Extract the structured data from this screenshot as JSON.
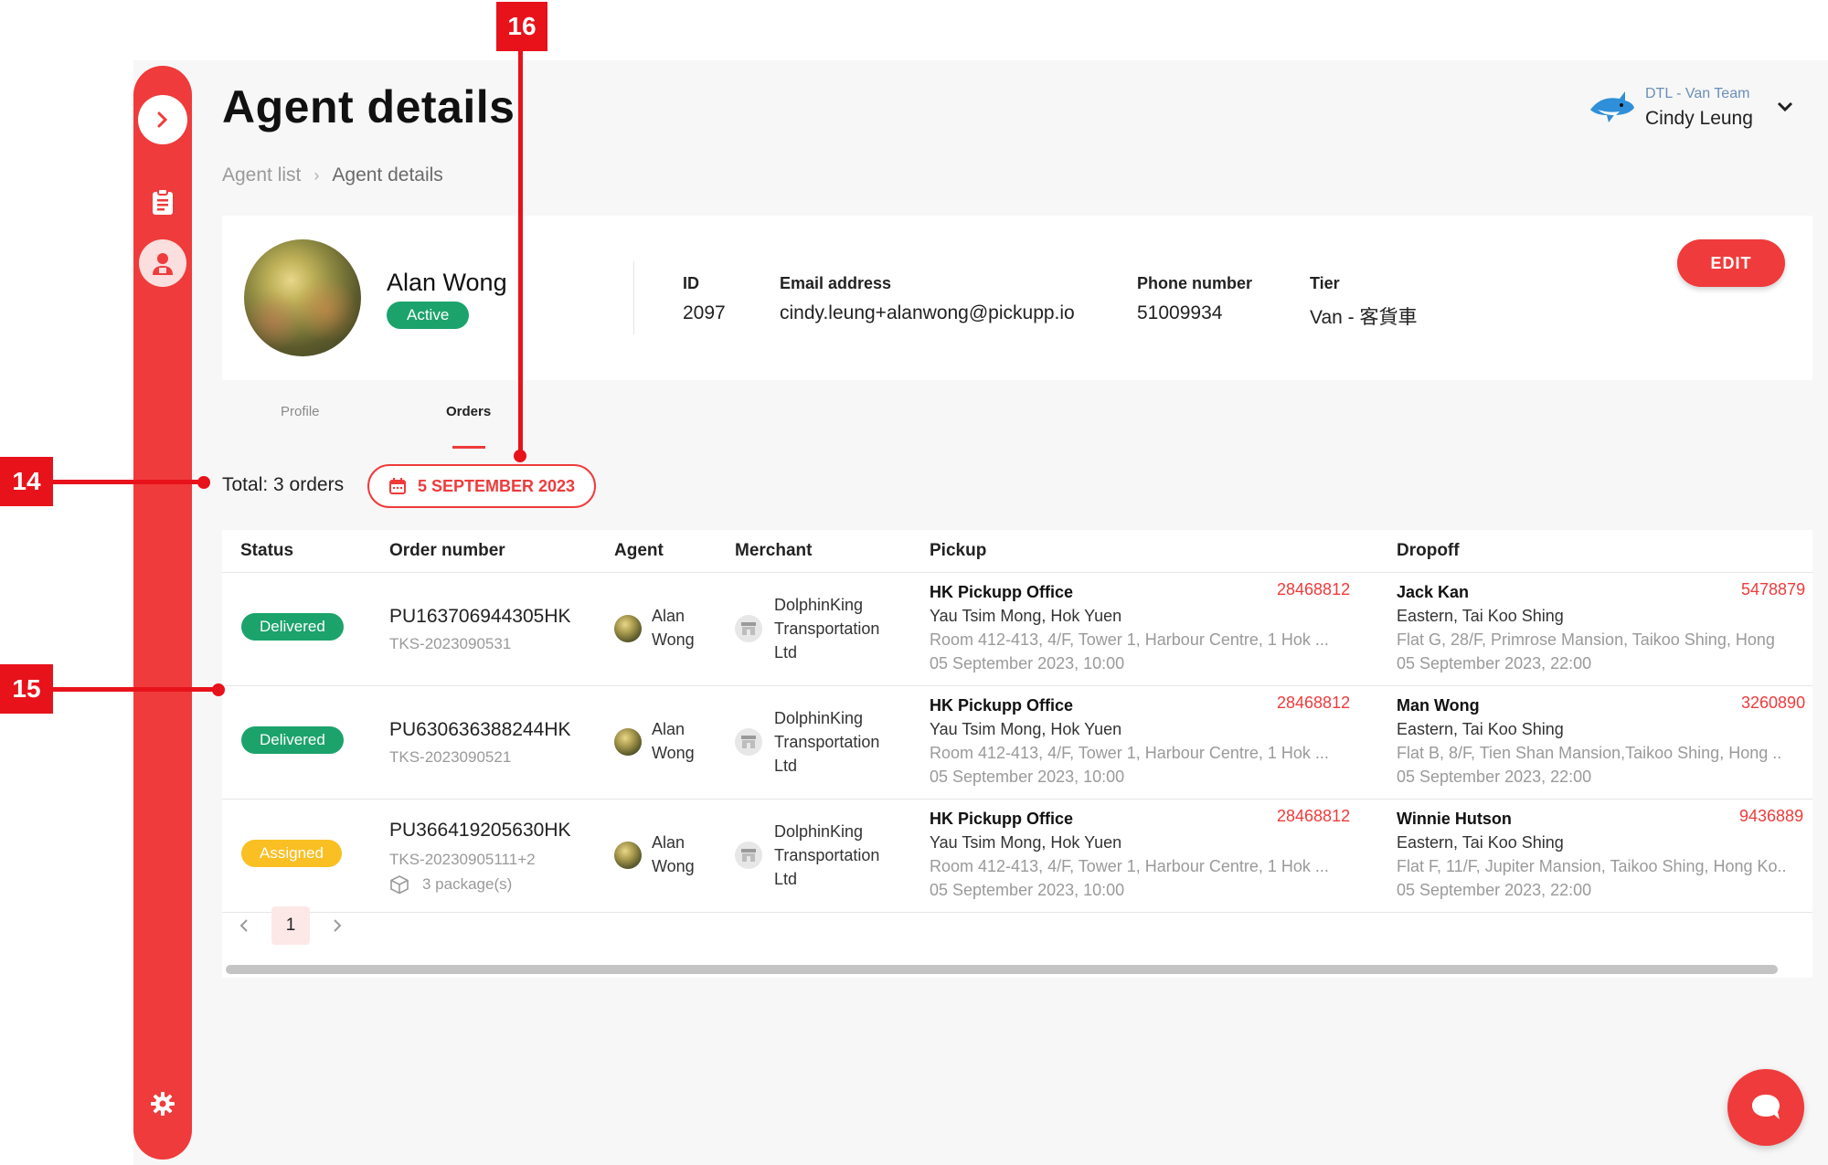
{
  "header": {
    "title": "Agent details",
    "breadcrumb": [
      "Agent list",
      "Agent details"
    ],
    "user": {
      "team": "DTL - Van Team",
      "name": "Cindy Leung"
    }
  },
  "sidebar": {
    "icons": [
      "chevron-right-icon",
      "clipboard-icon",
      "agent-icon",
      "gear-icon"
    ]
  },
  "agent": {
    "name": "Alan Wong",
    "status": "Active",
    "fields": [
      {
        "label": "ID",
        "value": "2097"
      },
      {
        "label": "Email address",
        "value": "cindy.leung+alanwong@pickupp.io"
      },
      {
        "label": "Phone number",
        "value": "51009934"
      },
      {
        "label": "Tier",
        "value": "Van - 客貨車"
      }
    ],
    "edit_label": "EDIT"
  },
  "tabs": [
    "Profile",
    "Orders"
  ],
  "orders": {
    "total_label": "Total: 3 orders",
    "date_filter": "5 SEPTEMBER 2023",
    "columns": [
      "Status",
      "Order number",
      "Agent",
      "Merchant",
      "Pickup",
      "Dropoff"
    ],
    "rows": [
      {
        "status": "Delivered",
        "order_number": "PU163706944305HK",
        "sub_id": "TKS-2023090531",
        "agent_first": "Alan",
        "agent_last": "Wong",
        "merchant": [
          "DolphinKing",
          "Transportation",
          "Ltd"
        ],
        "pickup": {
          "name": "HK Pickupp Office",
          "phone": "28468812",
          "area": "Yau Tsim Mong, Hok Yuen",
          "address": "Room 412-413, 4/F, Tower 1, Harbour Centre, 1 Hok ...",
          "time": "05 September 2023, 10:00"
        },
        "dropoff": {
          "name": "Jack Kan",
          "phone": "5478879",
          "area": "Eastern, Tai Koo Shing",
          "address": "Flat G, 28/F, Primrose Mansion, Taikoo Shing, Hong",
          "time": "05 September 2023, 22:00"
        }
      },
      {
        "status": "Delivered",
        "order_number": "PU630636388244HK",
        "sub_id": "TKS-2023090521",
        "agent_first": "Alan",
        "agent_last": "Wong",
        "merchant": [
          "DolphinKing",
          "Transportation",
          "Ltd"
        ],
        "pickup": {
          "name": "HK Pickupp Office",
          "phone": "28468812",
          "area": "Yau Tsim Mong, Hok Yuen",
          "address": "Room 412-413, 4/F, Tower 1, Harbour Centre, 1 Hok ...",
          "time": "05 September 2023, 10:00"
        },
        "dropoff": {
          "name": "Man Wong",
          "phone": "3260890",
          "area": "Eastern, Tai Koo Shing",
          "address": "Flat B, 8/F, Tien Shan Mansion,Taikoo Shing, Hong ..",
          "time": "05 September 2023, 22:00"
        }
      },
      {
        "status": "Assigned",
        "order_number": "PU366419205630HK",
        "sub_id": "TKS-20230905111+2",
        "packages": "3 package(s)",
        "agent_first": "Alan",
        "agent_last": "Wong",
        "merchant": [
          "DolphinKing",
          "Transportation",
          "Ltd"
        ],
        "pickup": {
          "name": "HK Pickupp Office",
          "phone": "28468812",
          "area": "Yau Tsim Mong, Hok Yuen",
          "address": "Room 412-413, 4/F, Tower 1, Harbour Centre, 1 Hok ...",
          "time": "05 September 2023, 10:00"
        },
        "dropoff": {
          "name": "Winnie Hutson",
          "phone": "9436889",
          "area": "Eastern, Tai Koo Shing",
          "address": "Flat F, 11/F, Jupiter Mansion, Taikoo Shing, Hong Ko..",
          "time": "05 September 2023, 22:00"
        }
      }
    ],
    "pagination": {
      "current_page": "1"
    }
  },
  "annotations": [
    "14",
    "15",
    "16"
  ],
  "colors": {
    "brand_red": "#ef3b3b",
    "delivered_green": "#1ba36b",
    "assigned_yellow": "#f9bf23",
    "annotation_red": "#e8121b"
  }
}
